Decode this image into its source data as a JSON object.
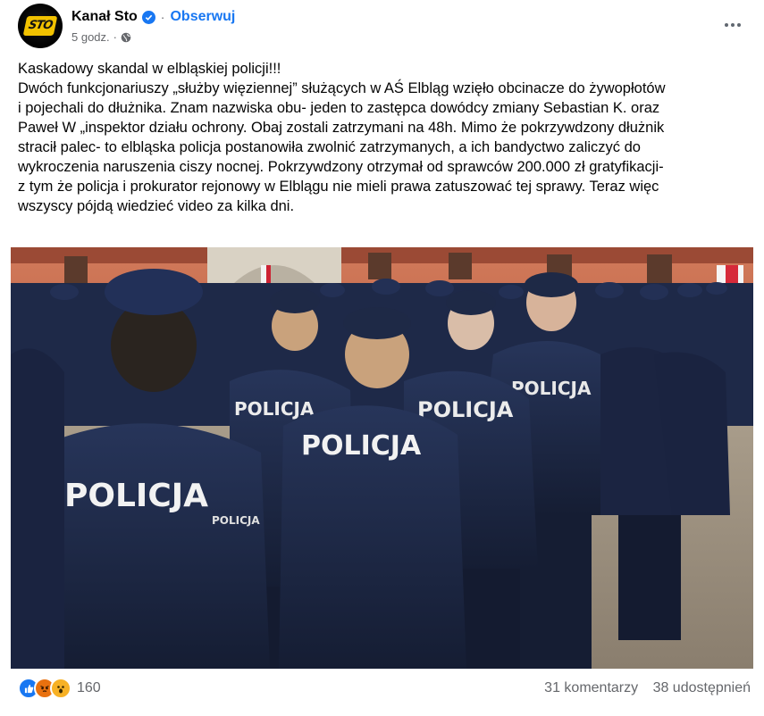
{
  "post": {
    "page_name": "Kanał Sto",
    "verified": true,
    "follow_label": "Obserwuj",
    "time": "5 godz.",
    "audience_icon": "globe-icon",
    "more_icon": "more-dots-icon",
    "text_lines": [
      "Kaskadowy skandal w elbląskiej policji!!!",
      "Dwóch funkcjonariuszy „służby więziennej” służących w AŚ Elbląg wzięło obcinacze do żywopłotów",
      "i pojechali do dłużnika. Znam nazwiska obu- jeden to zastępca dowódcy zmiany Sebastian K. oraz",
      "Paweł W „inspektor działu ochrony. Obaj zostali zatrzymani na 48h. Mimo że pokrzywdzony dłużnik",
      "stracił palec- to elbląska policja postanowiła zwolnić zatrzymanych, a ich bandyctwo zaliczyć do",
      "wykroczenia naruszenia ciszy nocnej. Pokrzywdzony otrzymał od sprawców 200.000 zł gratyfikacji-",
      "z tym że policja i prokurator rejonowy w Elblągu nie mieli prawa zatuszować tej sprawy. Teraz więc",
      "wszyscy pójdą wiedzieć video za kilka dni."
    ],
    "photo": {
      "uniform_text": "POLICJA",
      "colors": {
        "uniform": "#1f2a44",
        "building": "#c96a4c",
        "ground": "#9c9080"
      }
    },
    "reactions": {
      "icons": [
        "like-icon",
        "angry-icon",
        "wow-icon"
      ],
      "count": "160"
    },
    "comments": "31 komentarzy",
    "shares": "38 udostępnień"
  },
  "colors": {
    "accent": "#1877f2",
    "muted": "#65676b"
  }
}
